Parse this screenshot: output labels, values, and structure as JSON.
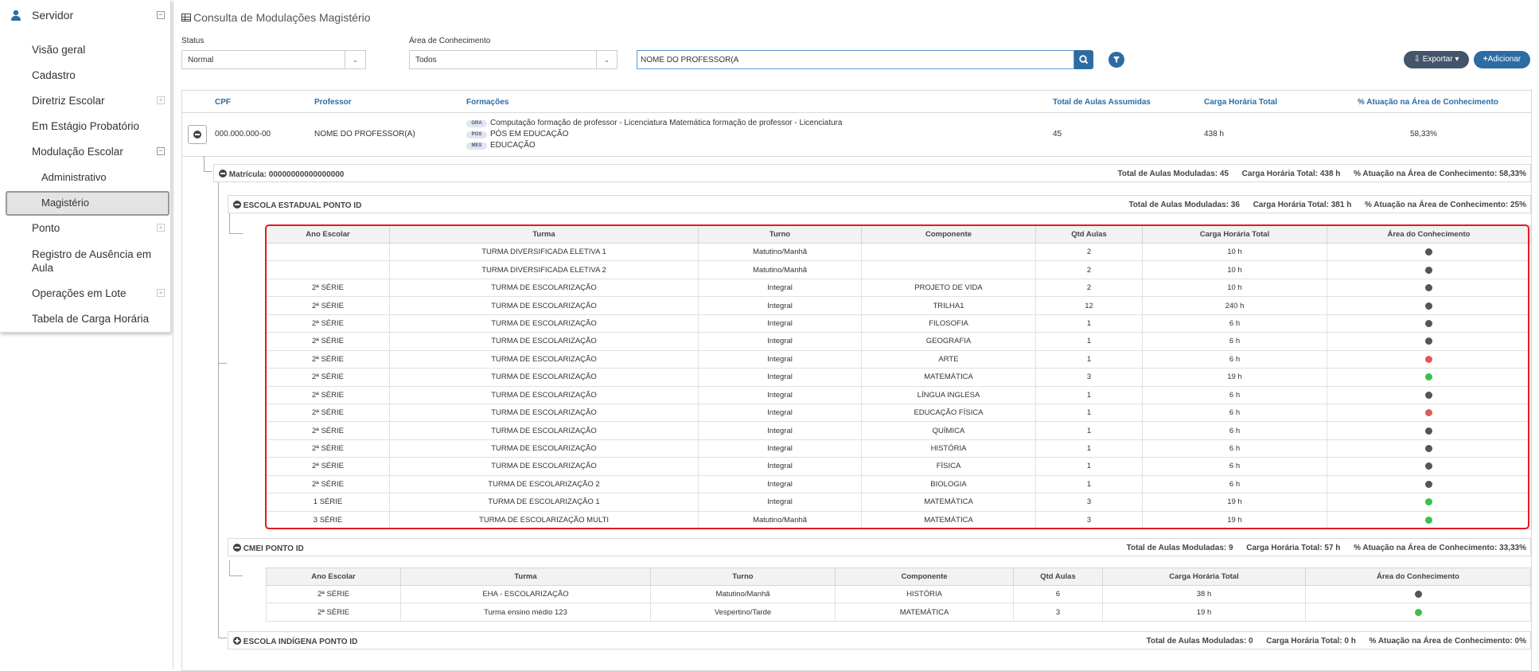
{
  "colors": {
    "primary": "#2d6ca2",
    "dark_button": "#44546a",
    "highlight": "#e31b23",
    "dot_gray": "#555555",
    "dot_red": "#e05a5a",
    "dot_green": "#3bbf50"
  },
  "sidebar": {
    "header": "Servidor",
    "items": [
      {
        "label": "Visão geral"
      },
      {
        "label": "Cadastro"
      },
      {
        "label": "Diretriz Escolar"
      },
      {
        "label": "Em Estágio Probatório"
      },
      {
        "label": "Modulação Escolar"
      },
      {
        "label": "Administrativo"
      },
      {
        "label": "Magistério"
      },
      {
        "label": "Ponto"
      },
      {
        "label": "Registro de Ausência em Aula"
      },
      {
        "label": "Operações em Lote"
      },
      {
        "label": "Tabela de Carga Horária"
      }
    ]
  },
  "page": {
    "title": "Consulta de Modulações Magistério"
  },
  "filters": {
    "status_label": "Status",
    "status_value": "Normal",
    "area_label": "Área de Conhecimento",
    "area_value": "Todos",
    "search_value": "NOME DO PROFESSOR(A"
  },
  "actions": {
    "export": "Exportar",
    "add": "Adicionar"
  },
  "header_cols": {
    "cpf": "CPF",
    "professor": "Professor",
    "formacoes": "Formações",
    "total_aulas": "Total de Aulas Assumidas",
    "carga": "Carga Horária Total",
    "atuacao": "% Atuação na Área de Conhecimento"
  },
  "professor_row": {
    "cpf": "000.000.000-00",
    "nome": "NOME DO PROFESSOR(A)",
    "formacoes": [
      {
        "badge": "GRA",
        "text": "Computação formação de professor - Licenciatura Matemática formação de professor - Licenciatura"
      },
      {
        "badge": "POS",
        "text": "PÓS EM EDUCAÇÃO"
      },
      {
        "badge": "MES",
        "text": "EDUCAÇÃO"
      }
    ],
    "total_aulas": "45",
    "carga": "438 h",
    "atuacao": "58,33%"
  },
  "matricula": {
    "title": "Matrícula: 00000000000000000",
    "stats": "Total de Aulas Moduladas: 45      Carga Horária Total: 438 h      % Atuação na Área de Conhecimento: 58,33%"
  },
  "table_headers": [
    "Ano Escolar",
    "Turma",
    "Turno",
    "Componente",
    "Qtd Aulas",
    "Carga Horária Total",
    "Área do Conhecimento"
  ],
  "escola1": {
    "title": "ESCOLA ESTADUAL PONTO ID",
    "stats": "Total de Aulas Moduladas: 36      Carga Horária Total: 381 h      % Atuação na Área de Conhecimento: 25%",
    "rows": [
      [
        "",
        "TURMA DIVERSIFICADA ELETIVA 1",
        "Matutino/Manhã",
        "",
        "2",
        "10 h",
        "gray"
      ],
      [
        "",
        "TURMA DIVERSIFICADA ELETIVA 2",
        "Matutino/Manhã",
        "",
        "2",
        "10 h",
        "gray"
      ],
      [
        "2ª SÉRIE",
        "TURMA DE ESCOLARIZAÇÃO",
        "Integral",
        "PROJETO DE VIDA",
        "2",
        "10 h",
        "gray"
      ],
      [
        "2ª SÉRIE",
        "TURMA DE ESCOLARIZAÇÃO",
        "Integral",
        "TRILHA1",
        "12",
        "240 h",
        "gray"
      ],
      [
        "2ª SÉRIE",
        "TURMA DE ESCOLARIZAÇÃO",
        "Integral",
        "FILOSOFIA",
        "1",
        "6 h",
        "gray"
      ],
      [
        "2ª SÉRIE",
        "TURMA DE ESCOLARIZAÇÃO",
        "Integral",
        "GEOGRAFIA",
        "1",
        "6 h",
        "gray"
      ],
      [
        "2ª SÉRIE",
        "TURMA DE ESCOLARIZAÇÃO",
        "Integral",
        "ARTE",
        "1",
        "6 h",
        "red"
      ],
      [
        "2ª SÉRIE",
        "TURMA DE ESCOLARIZAÇÃO",
        "Integral",
        "MATEMÁTICA",
        "3",
        "19 h",
        "green"
      ],
      [
        "2ª SÉRIE",
        "TURMA DE ESCOLARIZAÇÃO",
        "Integral",
        "LÍNGUA INGLESA",
        "1",
        "6 h",
        "gray"
      ],
      [
        "2ª SÉRIE",
        "TURMA DE ESCOLARIZAÇÃO",
        "Integral",
        "EDUCAÇÃO FÍSICA",
        "1",
        "6 h",
        "red"
      ],
      [
        "2ª SÉRIE",
        "TURMA DE ESCOLARIZAÇÃO",
        "Integral",
        "QUÍMICA",
        "1",
        "6 h",
        "gray"
      ],
      [
        "2ª SÉRIE",
        "TURMA DE ESCOLARIZAÇÃO",
        "Integral",
        "HISTÓRIA",
        "1",
        "6 h",
        "gray"
      ],
      [
        "2ª SÉRIE",
        "TURMA DE ESCOLARIZAÇÃO",
        "Integral",
        "FÍSICA",
        "1",
        "6 h",
        "gray"
      ],
      [
        "2ª SÉRIE",
        "TURMA DE ESCOLARIZAÇÃO 2",
        "Integral",
        "BIOLOGIA",
        "1",
        "6 h",
        "gray"
      ],
      [
        "1 SÉRIE",
        "TURMA DE ESCOLARIZAÇÃO 1",
        "Integral",
        "MATEMÁTICA",
        "3",
        "19 h",
        "green"
      ],
      [
        "3 SÉRIE",
        "TURMA DE ESCOLARIZAÇÃO MULTI",
        "Matutino/Manhã",
        "MATEMÁTICA",
        "3",
        "19 h",
        "green"
      ]
    ]
  },
  "escola2": {
    "title": "CMEI PONTO ID",
    "stats": "Total de Aulas Moduladas: 9      Carga Horária Total: 57 h      % Atuação na Área de Conhecimento: 33,33%",
    "rows": [
      [
        "2ª SÉRIE",
        "EHA - ESCOLARIZAÇÃO",
        "Matutino/Manhã",
        "HISTÓRIA",
        "6",
        "38 h",
        "gray"
      ],
      [
        "2ª SÉRIE",
        "Turma ensino médio 123",
        "Vespertino/Tarde",
        "MATEMÁTICA",
        "3",
        "19 h",
        "green"
      ]
    ]
  },
  "escola3": {
    "title": "ESCOLA INDÍGENA PONTO ID",
    "stats": "Total de Aulas Moduladas: 0      Carga Horária Total: 0 h      % Atuação na Área de Conhecimento: 0%"
  }
}
